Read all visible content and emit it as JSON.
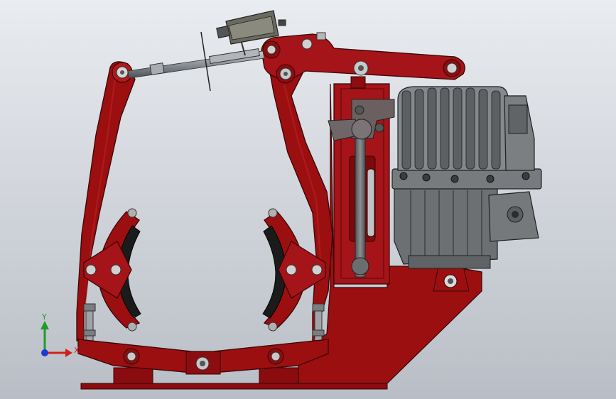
{
  "scene": {
    "background_top": "#e9ecf0",
    "background_bottom": "#b9bec6"
  },
  "colors": {
    "frame_red": "#9b0f10",
    "frame_red_dark": "#5e0608",
    "frame_red_light": "#c4262a",
    "lining_black": "#1b1b1b",
    "thruster_gray": "#6f7274",
    "thruster_gray_dark": "#2d2f30",
    "thruster_gray_light": "#a7abad",
    "steel": "#9da3a8"
  },
  "triad": {
    "x_label": "X",
    "y_label": "Y",
    "x_color": "#d0201c",
    "y_color": "#1f9b2b",
    "z_color": "#1b3ad1"
  },
  "icons": [
    "coordinate-triad-icon"
  ]
}
